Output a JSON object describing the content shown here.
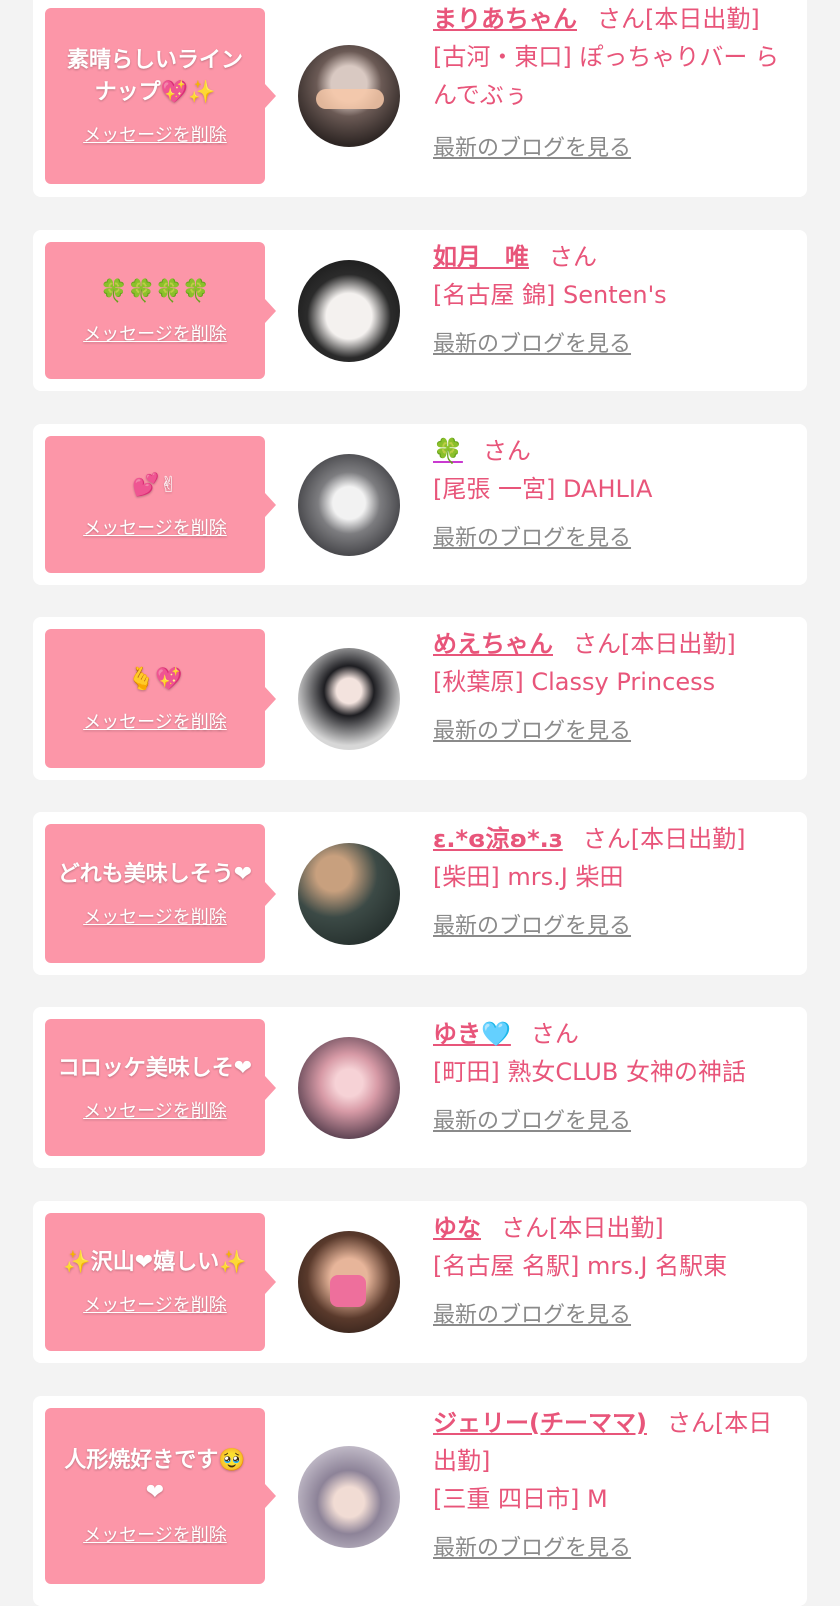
{
  "colors": {
    "accent_pink": "#e8557a",
    "bubble_pink": "#fc96a8",
    "blog_gray": "#8a8a8a",
    "background": "#f3f3f3"
  },
  "cards": [
    {
      "message": "素晴らしいラインナップ💖✨",
      "delete_label": "メッセージを削除",
      "name": "まりあちゃん",
      "suffix": "さん[本日出勤]",
      "shop": "[古河・東口] ぽっちゃりバー らんでぶぅ",
      "blog_label": "最新のブログを見る",
      "avatar_icon": "avatar-photo"
    },
    {
      "message": "🍀🍀🍀🍀",
      "delete_label": "メッセージを削除",
      "name": "如月　唯",
      "suffix": "さん",
      "shop": "[名古屋 錦] Senten's",
      "blog_label": "最新のブログを見る",
      "avatar_icon": "avatar-photo"
    },
    {
      "message": "💕✌",
      "delete_label": "メッセージを削除",
      "name": "🍀",
      "suffix": "さん",
      "shop": "[尾張 一宮] DAHLIA",
      "blog_label": "最新のブログを見る",
      "avatar_icon": "avatar-photo"
    },
    {
      "message": "🫰💖",
      "delete_label": "メッセージを削除",
      "name": "めえちゃん",
      "suffix": "さん[本日出勤]",
      "shop": "[秋葉原] Classy Princess",
      "blog_label": "最新のブログを見る",
      "avatar_icon": "avatar-photo"
    },
    {
      "message": "どれも美味しそう❤",
      "delete_label": "メッセージを削除",
      "name": "ε.*ɞ涼ʚ*.з",
      "suffix": "さん[本日出勤]",
      "shop": "[柴田] mrs.J 柴田",
      "blog_label": "最新のブログを見る",
      "avatar_icon": "avatar-photo"
    },
    {
      "message": "コロッケ美味しそ❤",
      "delete_label": "メッセージを削除",
      "name": "ゆき🩵",
      "suffix": "さん",
      "shop": "[町田] 熟女CLUB 女神の神話",
      "blog_label": "最新のブログを見る",
      "avatar_icon": "avatar-photo"
    },
    {
      "message": "✨沢山❤嬉しい✨",
      "delete_label": "メッセージを削除",
      "name": "ゆな",
      "suffix": "さん[本日出勤]",
      "shop": "[名古屋 名駅] mrs.J 名駅東",
      "blog_label": "最新のブログを見る",
      "avatar_icon": "avatar-photo"
    },
    {
      "message": "人形焼好きです🥹❤",
      "delete_label": "メッセージを削除",
      "name": "ジェリー(チーママ)",
      "suffix": "さん[本日出勤]",
      "shop": "[三重 四日市] M",
      "blog_label": "最新のブログを見る",
      "avatar_icon": "avatar-photo"
    }
  ]
}
